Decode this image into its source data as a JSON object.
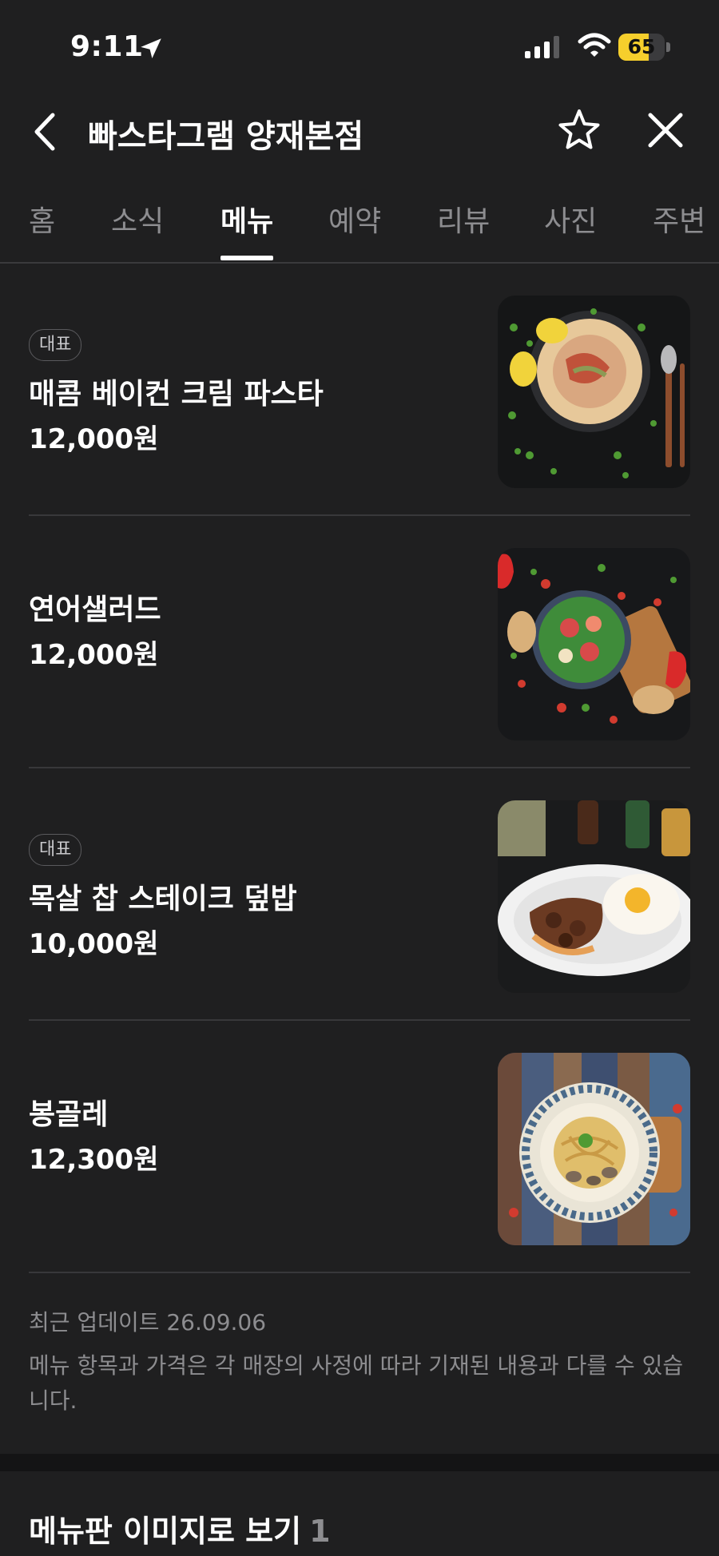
{
  "status_bar": {
    "time": "9:11",
    "battery": "65",
    "battery_level": 0.65
  },
  "header": {
    "title": "빠스타그램 양재본점"
  },
  "tabs": [
    "홈",
    "소식",
    "메뉴",
    "예약",
    "리뷰",
    "사진",
    "주변"
  ],
  "active_tab": "메뉴",
  "menu_items": [
    {
      "badge": "대표",
      "name": "매콤 베이컨 크림 파스타",
      "price": "12,000원"
    },
    {
      "badge": "",
      "name": "연어샐러드",
      "price": "12,000원"
    },
    {
      "badge": "대표",
      "name": "목살 찹 스테이크 덮밥",
      "price": "10,000원"
    },
    {
      "badge": "",
      "name": "봉골레",
      "price": "12,300원"
    }
  ],
  "footer": {
    "updated": "최근 업데이트 26.09.06",
    "disclaimer": "메뉴 항목과 가격은 각 매장의 사정에 따라 기재된 내용과 다를 수 있습니다."
  },
  "menu_board": {
    "title": "메뉴판 이미지로 보기",
    "count": "1"
  },
  "colors": {
    "background": "#1f1f20",
    "text": "#ffffff",
    "muted": "#8d8d90",
    "battery": "#f6cf2c"
  }
}
